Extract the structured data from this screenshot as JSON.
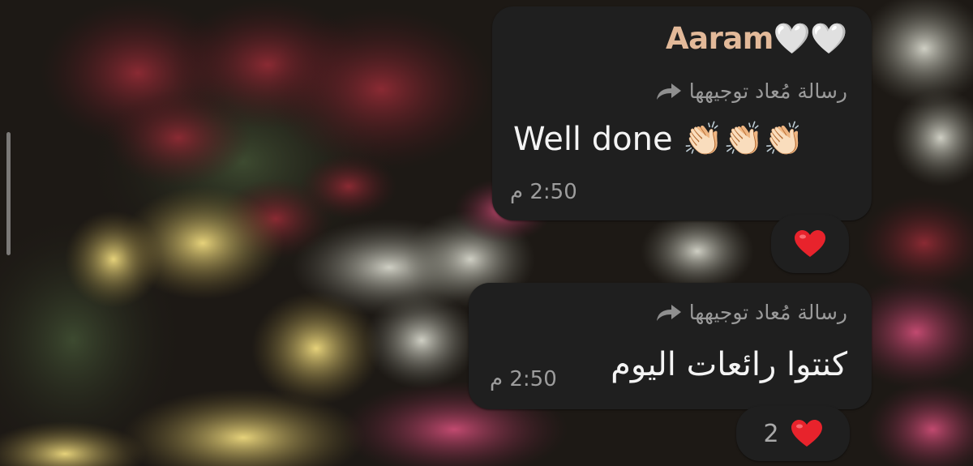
{
  "messages": [
    {
      "sender": "Aaram🤍🤍",
      "forwarded_label": "رسالة مُعاد توجيهها",
      "text": "Well done 👏🏻👏🏻👏🏻",
      "time": "2:50 م",
      "reaction": {
        "emoji": "heart",
        "count": ""
      }
    },
    {
      "forwarded_label": "رسالة مُعاد توجيهها",
      "text": "كنتوا رائعات اليوم",
      "time": "2:50 م",
      "reaction": {
        "emoji": "heart",
        "count": "2"
      }
    }
  ],
  "colors": {
    "bubble": "#1f1f1f",
    "sender": "#e2b999",
    "message_text": "#f4f4f4",
    "secondary_text": "#9d9d9d",
    "heart": "#e8232c"
  }
}
